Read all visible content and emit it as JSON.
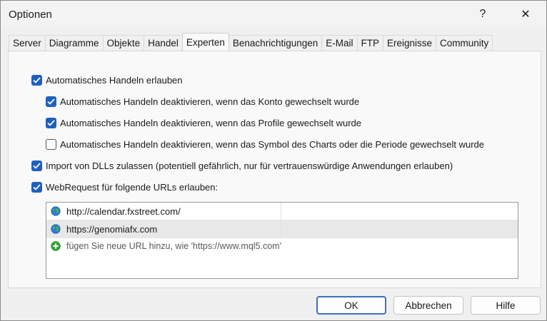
{
  "window": {
    "title": "Optionen",
    "help_glyph": "?",
    "close_glyph": "✕"
  },
  "tabs": [
    {
      "label": "Server"
    },
    {
      "label": "Diagramme"
    },
    {
      "label": "Objekte"
    },
    {
      "label": "Handel"
    },
    {
      "label": "Experten",
      "active": true
    },
    {
      "label": "Benachrichtigungen"
    },
    {
      "label": "E-Mail"
    },
    {
      "label": "FTP"
    },
    {
      "label": "Ereignisse"
    },
    {
      "label": "Community"
    }
  ],
  "options": {
    "auto_trading": {
      "label": "Automatisches Handeln erlauben",
      "checked": true
    },
    "disable_on_account": {
      "label": "Automatisches Handeln deaktivieren, wenn das Konto gewechselt wurde",
      "checked": true
    },
    "disable_on_profile": {
      "label": "Automatisches Handeln deaktivieren, wenn das Profile gewechselt wurde",
      "checked": true
    },
    "disable_on_symbol": {
      "label": "Automatisches Handeln deaktivieren, wenn das Symbol des Charts oder die Periode gewechselt wurde",
      "checked": false
    },
    "allow_dll": {
      "label": "Import von DLLs zulassen (potentiell gefährlich, nur für vertrauenswürdige Anwendungen erlauben)",
      "checked": true
    },
    "webrequest": {
      "label": "WebRequest für folgende URLs erlauben:",
      "checked": true
    }
  },
  "urls": {
    "items": [
      {
        "url": "http://calendar.fxstreet.com/",
        "icon": "globe-icon"
      },
      {
        "url": "https://genomiafx.com",
        "icon": "globe-icon",
        "selected": true
      }
    ],
    "add_hint": "fügen Sie neue URL hinzu, wie 'https://www.mql5.com'"
  },
  "buttons": {
    "ok": "OK",
    "cancel": "Abbrechen",
    "help": "Hilfe"
  },
  "colors": {
    "accent": "#1f5fbf",
    "selected_row": "#e8e8e8"
  }
}
